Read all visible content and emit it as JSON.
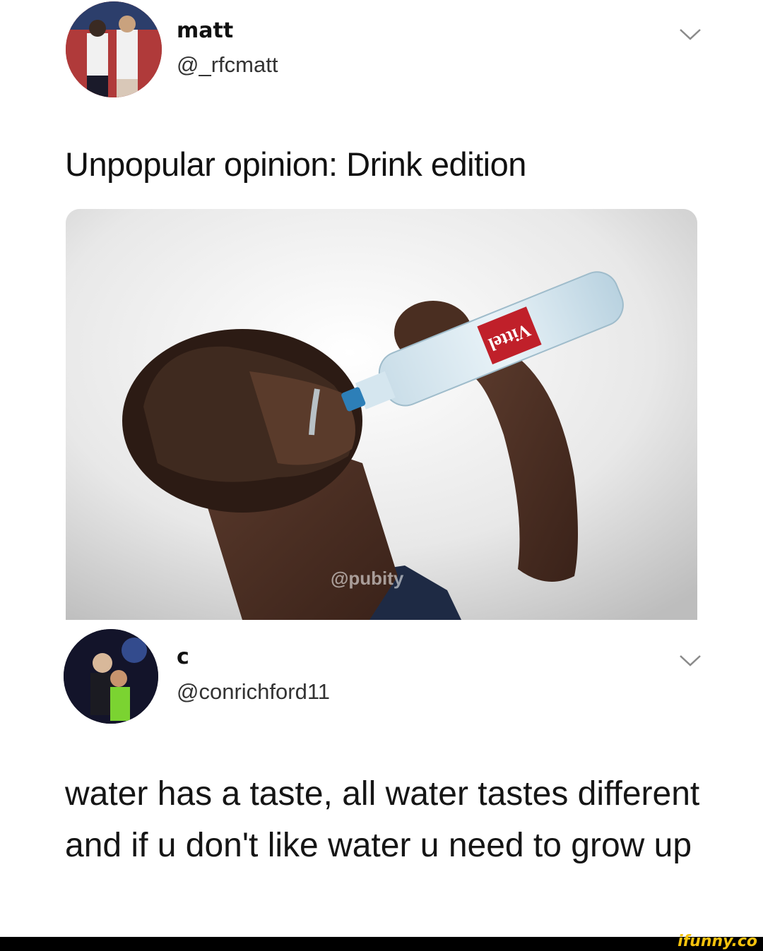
{
  "tweet1": {
    "name": "matt",
    "handle": "@_rfcmatt",
    "text": "Unpopular opinion: Drink edition",
    "chevron_icon": "chevron-down-icon",
    "media_watermark": "@pubity",
    "bottle_label": "Vittel"
  },
  "tweet2": {
    "name": "c",
    "handle": "@conrichford11",
    "text": "water has a taste, all water tastes different and if u don't like water u need to grow up",
    "chevron_icon": "chevron-down-icon"
  },
  "footer": {
    "watermark": "ifunny.co"
  },
  "colors": {
    "background": "#ffffff",
    "text": "#111111",
    "handle": "#333333",
    "footer_bar": "#000000",
    "watermark": "#f4c20d"
  }
}
